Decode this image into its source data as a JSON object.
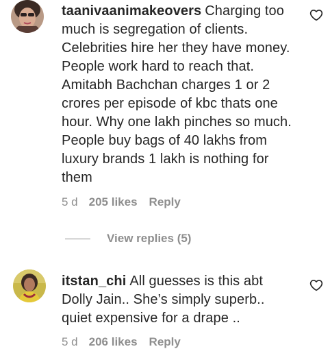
{
  "comments": [
    {
      "username": "taanivaanimakeovers",
      "text": "Charging too much is segregation of clients. Celebrities hire her they have money. People work hard to reach that. Amitabh Bachchan charges 1 or 2 crores per episode of kbc thats one hour. Why one lakh pinches so much. People buy bags of 40 lakhs from luxury brands 1 lakh is nothing for them",
      "age": "5 d",
      "likes": "205 likes",
      "reply": "Reply"
    },
    {
      "username": "itstan_chi",
      "text": "All guesses is this abt Dolly Jain.. She’s simply superb.. quiet expensive for a drape ..",
      "age": "5 d",
      "likes": "206 likes",
      "reply": "Reply"
    }
  ],
  "view_replies": "View replies (5)",
  "icons": {
    "like": "heart-icon",
    "avatar": "avatar"
  },
  "colors": {
    "text": "#262626",
    "secondary": "#8e8e8e"
  }
}
